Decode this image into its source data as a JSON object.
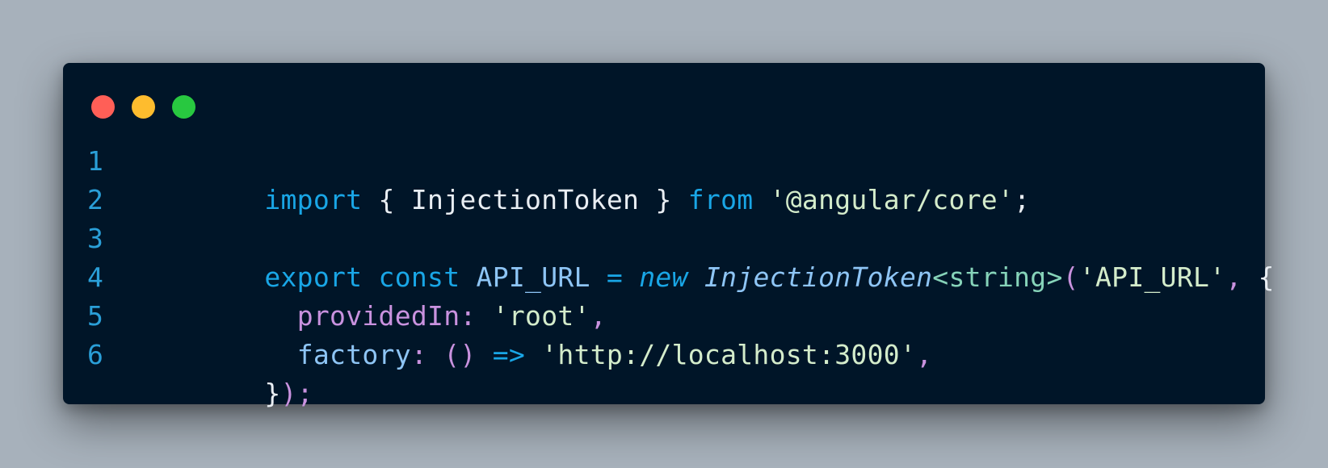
{
  "window": {
    "controls": [
      {
        "name": "close",
        "color": "#ff5f57"
      },
      {
        "name": "minimize",
        "color": "#febc2e"
      },
      {
        "name": "maximize",
        "color": "#28c840"
      }
    ]
  },
  "code": {
    "lines": [
      {
        "number": "1",
        "tokens": [
          {
            "text": "import",
            "role": "keyword"
          },
          {
            "text": " { ",
            "role": "plain"
          },
          {
            "text": "InjectionToken",
            "role": "plain"
          },
          {
            "text": " } ",
            "role": "plain"
          },
          {
            "text": "from",
            "role": "keyword"
          },
          {
            "text": " ",
            "role": "plain"
          },
          {
            "text": "'@angular/core'",
            "role": "string"
          },
          {
            "text": ";",
            "role": "plain"
          }
        ]
      },
      {
        "number": "2",
        "tokens": []
      },
      {
        "number": "3",
        "tokens": [
          {
            "text": "export",
            "role": "keyword"
          },
          {
            "text": " ",
            "role": "plain"
          },
          {
            "text": "const",
            "role": "keyword"
          },
          {
            "text": " ",
            "role": "plain"
          },
          {
            "text": "API_URL",
            "role": "identifier"
          },
          {
            "text": " ",
            "role": "plain"
          },
          {
            "text": "=",
            "role": "keyword"
          },
          {
            "text": " ",
            "role": "plain"
          },
          {
            "text": "new",
            "role": "new-italic"
          },
          {
            "text": " ",
            "role": "plain"
          },
          {
            "text": "InjectionToken",
            "role": "type-italic"
          },
          {
            "text": "<string>",
            "role": "typearg"
          },
          {
            "text": "(",
            "role": "punct"
          },
          {
            "text": "'API_URL'",
            "role": "string"
          },
          {
            "text": ",",
            "role": "punct"
          },
          {
            "text": " {",
            "role": "plain"
          }
        ]
      },
      {
        "number": "4",
        "tokens": [
          {
            "text": "  ",
            "role": "plain"
          },
          {
            "text": "providedIn",
            "role": "property"
          },
          {
            "text": ":",
            "role": "punct"
          },
          {
            "text": " ",
            "role": "plain"
          },
          {
            "text": "'root'",
            "role": "string"
          },
          {
            "text": ",",
            "role": "punct"
          }
        ]
      },
      {
        "number": "5",
        "tokens": [
          {
            "text": "  ",
            "role": "plain"
          },
          {
            "text": "factory",
            "role": "factory"
          },
          {
            "text": ":",
            "role": "punct"
          },
          {
            "text": " ",
            "role": "plain"
          },
          {
            "text": "()",
            "role": "punct"
          },
          {
            "text": " ",
            "role": "plain"
          },
          {
            "text": "=>",
            "role": "arrow"
          },
          {
            "text": " ",
            "role": "plain"
          },
          {
            "text": "'http://localhost:3000'",
            "role": "string"
          },
          {
            "text": ",",
            "role": "punct"
          }
        ]
      },
      {
        "number": "6",
        "tokens": [
          {
            "text": "}",
            "role": "plain"
          },
          {
            "text": ");",
            "role": "punct"
          }
        ]
      }
    ]
  }
}
